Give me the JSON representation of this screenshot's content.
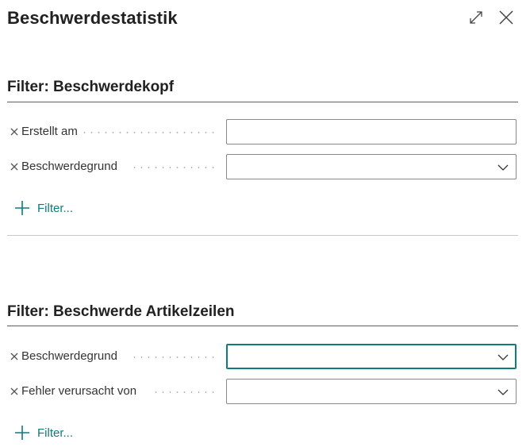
{
  "dialog": {
    "title": "Beschwerdestatistik",
    "expand_icon": "expand-icon",
    "close_icon": "close-icon"
  },
  "sections": [
    {
      "title": "Filter: Beschwerdekopf",
      "rows": [
        {
          "label": "Erstellt am",
          "type": "text",
          "value": ""
        },
        {
          "label": "Beschwerdegrund",
          "type": "dropdown",
          "value": ""
        }
      ],
      "add_filter_label": "Filter..."
    },
    {
      "title": "Filter: Beschwerde Artikelzeilen",
      "rows": [
        {
          "label": "Beschwerdegrund",
          "type": "dropdown",
          "value": "",
          "focused": true
        },
        {
          "label": "Fehler verursacht von",
          "type": "dropdown",
          "value": ""
        }
      ],
      "add_filter_label": "Filter..."
    }
  ],
  "colors": {
    "accent": "#0f7b7b",
    "text": "#212121",
    "field_border": "#8a8a8a"
  }
}
